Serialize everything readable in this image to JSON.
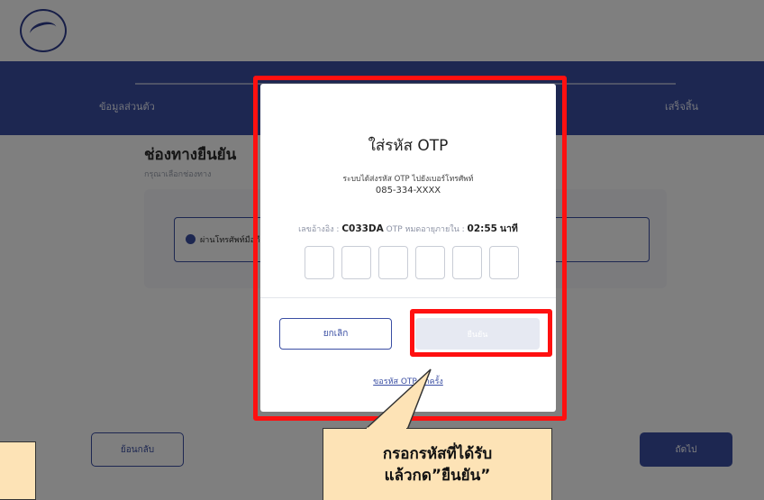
{
  "header": {
    "logo": "logo-icon"
  },
  "steps": {
    "step1": "ข้อมูลส่วนตัว",
    "step3": "เสร็จสิ้น"
  },
  "section": {
    "title": "ช่องทางยืนยัน",
    "subtitle": "กรุณาเลือกช่องทาง"
  },
  "choice": {
    "label": "ผ่านโทรศัพท์มือถือ"
  },
  "footer": {
    "back_label": "ย้อนกลับ",
    "next_label": "ถัดไป"
  },
  "modal": {
    "title": "ใส่รหัส OTP",
    "description": "ระบบได้ส่งรหัส OTP ไปยังเบอร์โทรศัพท์",
    "phone": "085-334-XXXX",
    "ref_label": "เลขอ้างอิง :",
    "ref_code": "C033DA",
    "expiry_label": "OTP หมดอายุภายใน :",
    "countdown": "02:55",
    "countdown_unit": "นาที",
    "otp_digits": [
      "",
      "",
      "",
      "",
      "",
      ""
    ],
    "cancel_label": "ยกเลิก",
    "confirm_label": "ยืนยัน",
    "resend_label": "ขอรหัส OTP อีกครั้ง"
  },
  "callout": {
    "line1": "กรอกรหัสที่ได้รับ",
    "line2": "แล้วกด”ยืนยัน”"
  },
  "colors": {
    "primary": "#3a4ea3",
    "highlight": "#ff1010",
    "callout_bg": "#fde3b6"
  }
}
